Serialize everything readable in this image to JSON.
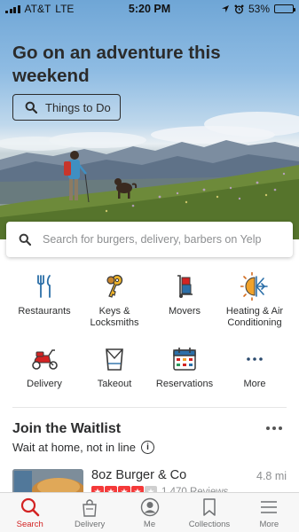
{
  "status_bar": {
    "carrier": "AT&T",
    "network": "LTE",
    "time": "5:20 PM",
    "battery": "53%",
    "battery_level": 0.53
  },
  "hero": {
    "title": "Go on an adventure this weekend",
    "button_label": "Things to Do"
  },
  "search": {
    "placeholder": "Search for burgers, delivery, barbers on Yelp"
  },
  "categories": [
    {
      "label": "Restaurants",
      "icon": "fork-knife-icon"
    },
    {
      "label": "Keys & Locksmiths",
      "icon": "keys-icon"
    },
    {
      "label": "Movers",
      "icon": "dolly-icon"
    },
    {
      "label": "Heating & Air Conditioning",
      "icon": "sun-snowflake-icon"
    },
    {
      "label": "Delivery",
      "icon": "scooter-icon"
    },
    {
      "label": "Takeout",
      "icon": "takeout-bag-icon"
    },
    {
      "label": "Reservations",
      "icon": "calendar-icon"
    },
    {
      "label": "More",
      "icon": "ellipsis-icon"
    }
  ],
  "waitlist": {
    "title": "Join the Waitlist",
    "subtitle": "Wait at home, not in line",
    "business": {
      "name": "8oz Burger & Co",
      "distance": "4.8 mi",
      "rating": 4,
      "reviews": "1,470 Reviews"
    }
  },
  "tabs": [
    {
      "label": "Search",
      "icon": "search-icon",
      "active": true
    },
    {
      "label": "Delivery",
      "icon": "delivery-bag-icon",
      "active": false
    },
    {
      "label": "Me",
      "icon": "profile-icon",
      "active": false
    },
    {
      "label": "Collections",
      "icon": "bookmark-icon",
      "active": false
    },
    {
      "label": "More",
      "icon": "menu-icon",
      "active": false
    }
  ],
  "colors": {
    "brand_red": "#d32323",
    "icon_blue": "#2b6fa8",
    "text": "#2d2e2f",
    "muted": "#8d8f91"
  }
}
